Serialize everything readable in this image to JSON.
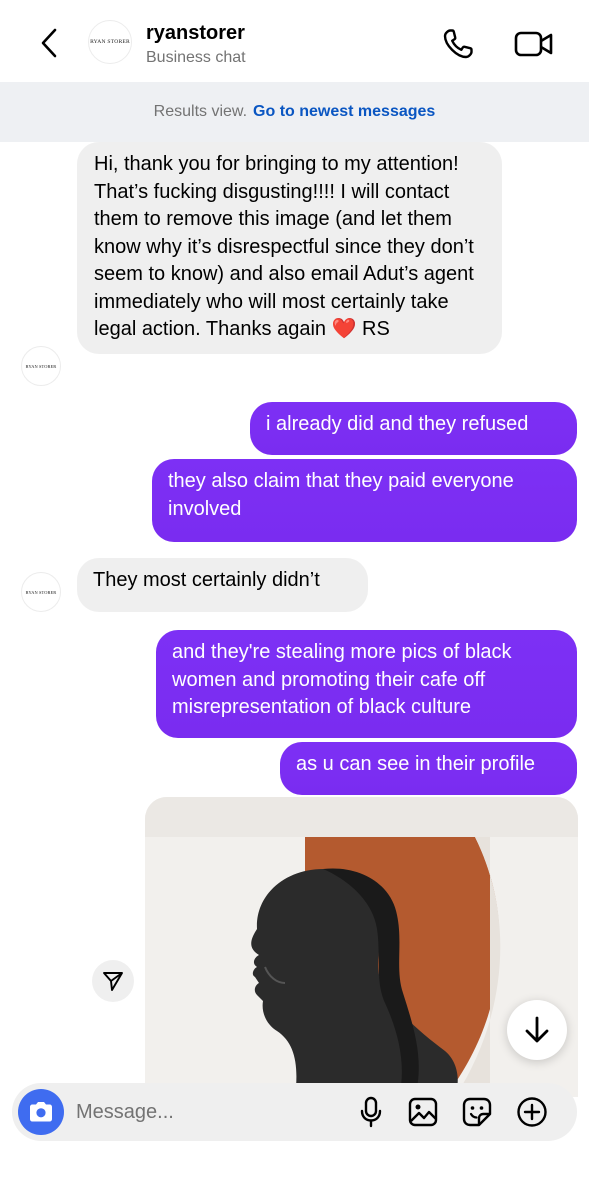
{
  "header": {
    "name": "ryanstorer",
    "subtitle": "Business chat",
    "avatar_text": "RYAN STORER"
  },
  "results": {
    "text": "Results view.",
    "link": "Go to newest messages"
  },
  "messages": [
    {
      "direction": "incoming",
      "text": "Hi, thank you for bringing to my attention! That’s fucking disgusting!!!! I will contact them to remove this image (and let them know why it’s disrespectful since they don’t seem to know) and also email Adut’s agent immediately who will most certainly take legal action. Thanks again ❤️ RS"
    },
    {
      "direction": "outgoing",
      "text": "i already did and they refused"
    },
    {
      "direction": "outgoing",
      "text": "they also claim that they paid everyone involved"
    },
    {
      "direction": "incoming",
      "text": "They most certainly didn’t"
    },
    {
      "direction": "outgoing",
      "text": "and they're stealing more pics of black women and promoting their cafe off misrepresentation of black culture"
    },
    {
      "direction": "outgoing",
      "text": "as u can see in their profile"
    }
  ],
  "composer": {
    "placeholder": "Message..."
  },
  "icons": {
    "back": "chevron-left-icon",
    "call": "phone-icon",
    "video": "video-camera-icon",
    "share": "paper-plane-icon",
    "scroll": "arrow-down-icon",
    "camera": "camera-icon",
    "mic": "microphone-icon",
    "gallery": "image-icon",
    "sticker": "sticker-icon",
    "add": "plus-circle-icon"
  },
  "colors": {
    "outgoing_bubble": "#7b2ff7",
    "incoming_bubble": "#efefef",
    "link": "#0a56c2",
    "camera_button": "#3f6cf0"
  }
}
